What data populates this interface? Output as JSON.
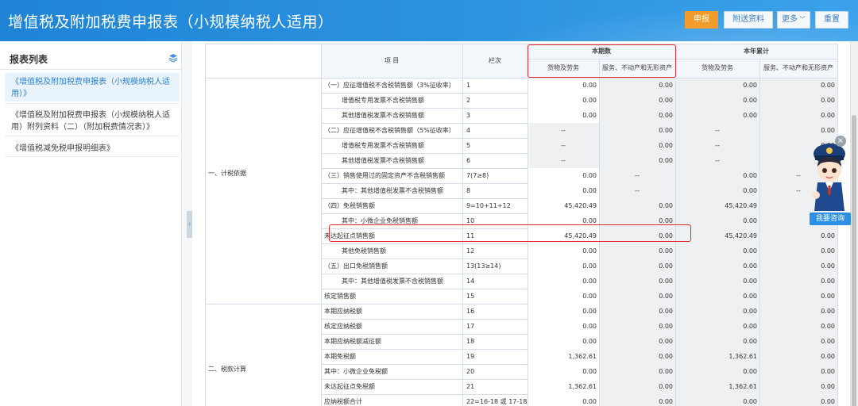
{
  "header": {
    "title": "增值税及附加税费申报表（小规模纳税人适用）",
    "buttons": {
      "submit": "申报",
      "attach": "附送资料",
      "more": "更多",
      "reset": "重置"
    }
  },
  "sidebar": {
    "title": "报表列表",
    "items": [
      {
        "label": "《增值税及附加税费申报表（小规模纳税人适用）》"
      },
      {
        "label": "《增值税及附加税费申报表（小规模纳税人适用）附列资料（二）（附加税费情况表）》"
      },
      {
        "label": "《增值税减免税申报明细表》"
      }
    ]
  },
  "table": {
    "headers": {
      "item": "项    目",
      "col_no": "栏次",
      "current_period": "本期数",
      "year_total": "本年累计",
      "goods": "货物及劳务",
      "services": "服务、不动产和无形资产"
    },
    "groups": {
      "basis": "一、计税依据",
      "calc": "二、税款计算"
    },
    "rows": [
      {
        "item": "（一）应征增值税不含税销售额（3%征收率）",
        "col": "1",
        "v": [
          "0.00",
          "0.00",
          "0.00",
          "0.00"
        ]
      },
      {
        "item": "增值税专用发票不含税销售额",
        "col": "2",
        "v": [
          "0.00",
          "0.00",
          "0.00",
          "0.00"
        ]
      },
      {
        "item": "其他增值税发票不含税销售额",
        "col": "3",
        "v": [
          "0.00",
          "0.00",
          "0.00",
          "0.00"
        ]
      },
      {
        "item": "（二）应征增值税不含税销售额（5%征收率）",
        "col": "4",
        "v": [
          "--",
          "0.00",
          "--",
          "0.00"
        ]
      },
      {
        "item": "增值税专用发票不含税销售额",
        "col": "5",
        "v": [
          "--",
          "0.00",
          "--",
          "0.00"
        ]
      },
      {
        "item": "其他增值税发票不含税销售额",
        "col": "6",
        "v": [
          "--",
          "0.00",
          "--",
          "0.00"
        ]
      },
      {
        "item": "（三）销售使用过的固定资产不含税销售额",
        "col": "7(7≥8)",
        "v": [
          "0.00",
          "--",
          "0.00",
          "--"
        ]
      },
      {
        "item": "其中：其他增值税发票不含税销售额",
        "col": "8",
        "v": [
          "0.00",
          "--",
          "0.00",
          "--"
        ]
      },
      {
        "item": "（四）免税销售额",
        "col": "9=10+11+12",
        "v": [
          "45,420.49",
          "0.00",
          "45,420.49",
          "0.00"
        ]
      },
      {
        "item": "其中：小微企业免税销售额",
        "col": "10",
        "v": [
          "0.00",
          "0.00",
          "0.00",
          "0.00"
        ]
      },
      {
        "item": "未达起征点销售额",
        "col": "11",
        "v": [
          "45,420.49",
          "0.00",
          "45,420.49",
          "0.00"
        ]
      },
      {
        "item": "其他免税销售额",
        "col": "12",
        "v": [
          "0.00",
          "0.00",
          "0.00",
          "0.00"
        ]
      },
      {
        "item": "（五）出口免税销售额",
        "col": "13(13≥14)",
        "v": [
          "0.00",
          "0.00",
          "0.00",
          "0.00"
        ]
      },
      {
        "item": "其中：其他增值税发票不含税销售额",
        "col": "14",
        "v": [
          "0.00",
          "0.00",
          "0.00",
          "0.00"
        ]
      },
      {
        "item": "核定销售额",
        "col": "15",
        "v": [
          "0.00",
          "0.00",
          "0.00",
          "0.00"
        ]
      },
      {
        "item": "本期应纳税额",
        "col": "16",
        "v": [
          "0.00",
          "0.00",
          "0.00",
          "0.00"
        ]
      },
      {
        "item": "核定应纳税额",
        "col": "17",
        "v": [
          "0.00",
          "0.00",
          "0.00",
          "0.00"
        ]
      },
      {
        "item": "本期应纳税额减征额",
        "col": "18",
        "v": [
          "0.00",
          "0.00",
          "0.00",
          "0.00"
        ]
      },
      {
        "item": "本期免税额",
        "col": "19",
        "v": [
          "1,362.61",
          "0.00",
          "1,362.61",
          "0.00"
        ]
      },
      {
        "item": "其中：小微企业免税额",
        "col": "20",
        "v": [
          "0.00",
          "0.00",
          "0.00",
          "0.00"
        ]
      },
      {
        "item": "未达起征点免税额",
        "col": "21",
        "v": [
          "1,362.61",
          "0.00",
          "1,362.61",
          "0.00"
        ]
      },
      {
        "item": "应纳税额合计",
        "col": "22=16-18 或 17-18",
        "v": [
          "0.00",
          "0.00",
          "0.00",
          "0.00"
        ]
      }
    ]
  },
  "assistant": {
    "label": "我要咨询"
  },
  "colors": {
    "header_blue": "#2589d9",
    "submit_orange": "#f29c2b",
    "highlight_red": "#e0292b"
  }
}
